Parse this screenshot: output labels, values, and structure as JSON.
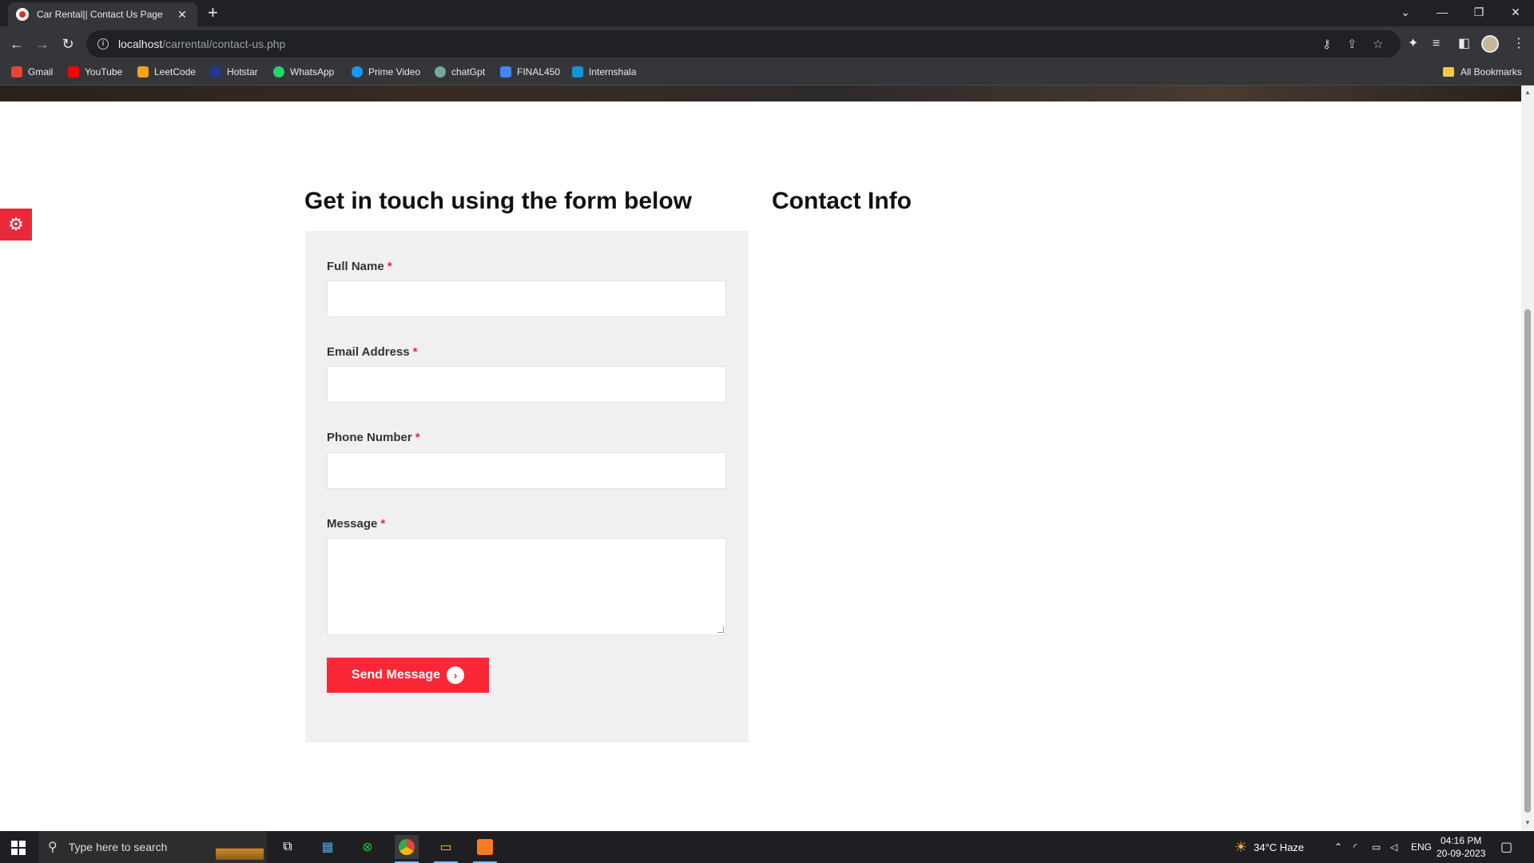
{
  "browser": {
    "tab_title": "Car Rental|| Contact Us Page",
    "tab_close": "✕",
    "new_tab": "+",
    "url_host": "localhost",
    "url_path": "/carrental/contact-us.php",
    "bookmarks": [
      {
        "label": "Gmail",
        "color": "#ea4335"
      },
      {
        "label": "YouTube",
        "color": "#ff0000"
      },
      {
        "label": "LeetCode",
        "color": "#ffa116"
      },
      {
        "label": "Hotstar",
        "color": "#1f3b8a"
      },
      {
        "label": "WhatsApp",
        "color": "#25d366"
      },
      {
        "label": "Prime Video",
        "color": "#1a98ff"
      },
      {
        "label": "chatGpt",
        "color": "#74aa9c"
      },
      {
        "label": "FINAL450",
        "color": "#4285f4"
      },
      {
        "label": "Internshala",
        "color": "#1295d8"
      }
    ],
    "all_bookmarks": "All Bookmarks"
  },
  "page": {
    "form_heading": "Get in touch using the form below",
    "contact_heading": "Contact Info",
    "form": {
      "full_name_label": "Full Name",
      "email_label": "Email Address",
      "phone_label": "Phone Number",
      "message_label": "Message",
      "required_mark": "*",
      "full_name_value": "",
      "email_value": "",
      "phone_value": "",
      "message_value": "",
      "submit_label": "Send Message",
      "submit_arrow": "›"
    },
    "accent_color": "#fa2837"
  },
  "taskbar": {
    "search_placeholder": "Type here to search",
    "weather": "34°C  Haze",
    "language": "ENG",
    "time": "04:16 PM",
    "date": "20-09-2023"
  }
}
